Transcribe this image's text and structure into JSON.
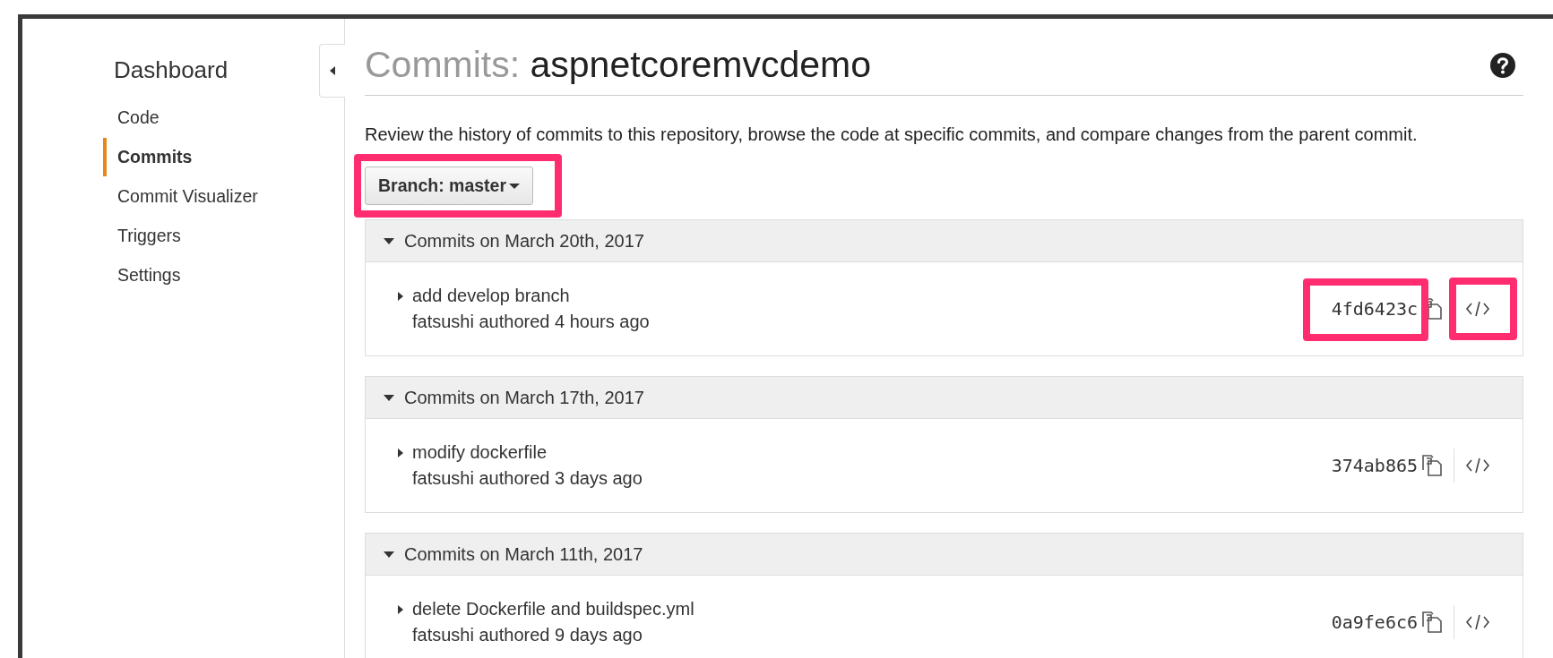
{
  "sidebar": {
    "title": "Dashboard",
    "items": [
      {
        "label": "Code",
        "selected": false
      },
      {
        "label": "Commits",
        "selected": true
      },
      {
        "label": "Commit Visualizer",
        "selected": false
      },
      {
        "label": "Triggers",
        "selected": false
      },
      {
        "label": "Settings",
        "selected": false
      }
    ]
  },
  "header": {
    "prefix": "Commits:",
    "repository": "aspnetcoremvcdemo"
  },
  "description": "Review the history of commits to this repository, browse the code at specific commits, and compare changes from the parent commit.",
  "branch_button": {
    "label": "Branch: master",
    "highlighted": true
  },
  "commit_groups": [
    {
      "date_label": "Commits on March 20th, 2017",
      "expanded": true,
      "commits": [
        {
          "message": "add develop branch",
          "author_line": "fatsushi authored 4 hours ago",
          "expanded": false,
          "hash": "4fd6423c",
          "hash_highlighted": true,
          "code_highlighted": true
        }
      ]
    },
    {
      "date_label": "Commits on March 17th, 2017",
      "expanded": true,
      "commits": [
        {
          "message": "modify dockerfile",
          "author_line": "fatsushi authored 3 days ago",
          "expanded": false,
          "hash": "374ab865",
          "hash_highlighted": false,
          "code_highlighted": false
        }
      ]
    },
    {
      "date_label": "Commits on March 11th, 2017",
      "expanded": true,
      "commits": [
        {
          "message": "delete Dockerfile and buildspec.yml",
          "author_line": "fatsushi authored 9 days ago",
          "expanded": false,
          "hash": "0a9fe6c6",
          "hash_highlighted": false,
          "code_highlighted": false
        }
      ]
    }
  ]
}
